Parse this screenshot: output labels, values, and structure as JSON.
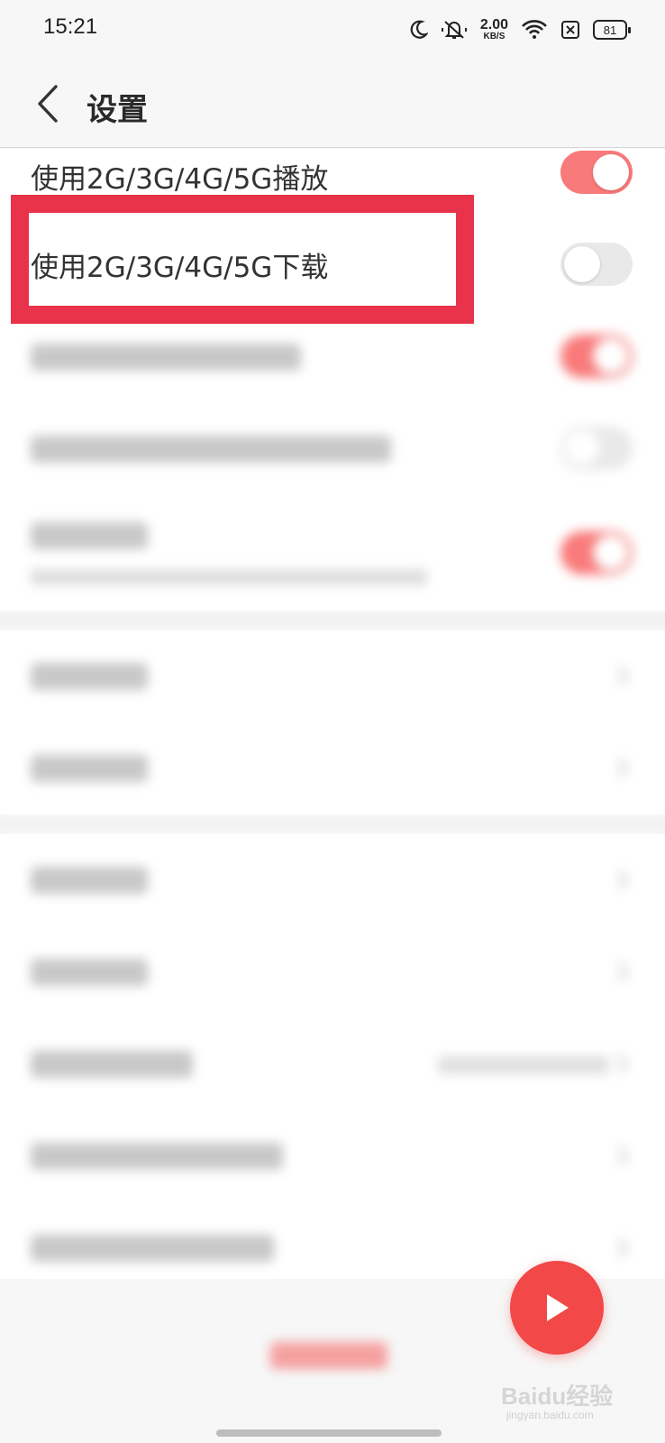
{
  "status": {
    "time": "15:21",
    "net_speed_value": "2.00",
    "net_speed_unit": "KB/S",
    "battery": "81",
    "icons": [
      "moon-icon",
      "mute-icon",
      "wifi-icon",
      "sim-blocked-icon",
      "battery-icon"
    ]
  },
  "header": {
    "back_icon": "back-chevron-icon",
    "title": "设置"
  },
  "settings": {
    "play_mobile_label": "使用2G/3G/4G/5G播放",
    "play_mobile_on": true,
    "download_mobile_label": "使用2G/3G/4G/5G下载",
    "download_mobile_on": false
  },
  "colors": {
    "accent": "#f97a7a",
    "highlight": "#e8334a",
    "fab": "#f24848"
  },
  "fab": {
    "icon": "play-icon"
  },
  "watermark": {
    "brand": "Baidu经验",
    "site": "jingyan.baidu.com"
  }
}
